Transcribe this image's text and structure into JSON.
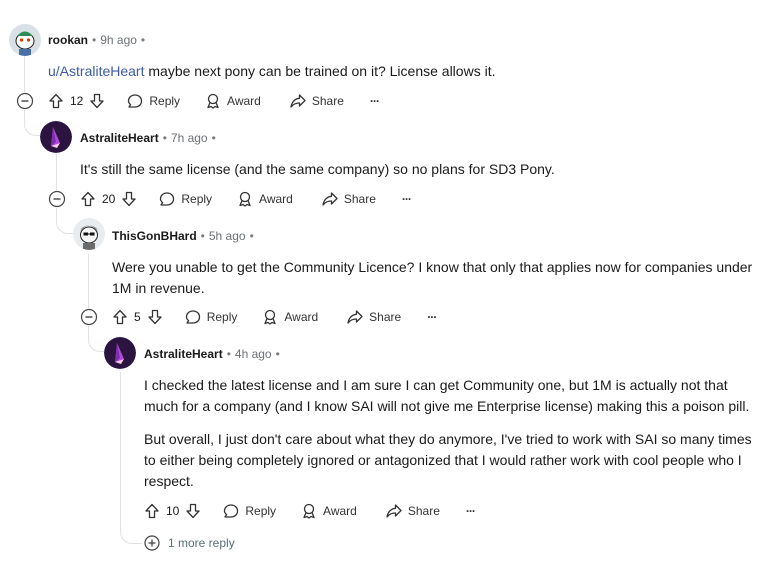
{
  "comments": [
    {
      "author": "rookan",
      "time": "9h ago",
      "mention": "u/AstraliteHeart",
      "body": "maybe next pony can be trained on it? License allows it.",
      "votes": "12"
    },
    {
      "author": "AstraliteHeart",
      "time": "7h ago",
      "body": "It's still the same license (and the same company) so no plans for SD3 Pony.",
      "votes": "20"
    },
    {
      "author": "ThisGonBHard",
      "time": "5h ago",
      "body_line1": "Were you unable to get the Community Licence? I know that only that applies now for companies under",
      "body_line2": "1M in revenue.",
      "votes": "5"
    },
    {
      "author": "AstraliteHeart",
      "time": "4h ago",
      "p1_line1": "I checked the latest license and I am sure I can get Community one, but 1M is actually not that",
      "p1_line2": "much for a company (and I know SAI will not give me Enterprise license) making this a poison pill.",
      "p2_line1": "But overall, I just don't care about what they do anymore, I've tried to work with SAI so many times",
      "p2_line2": "to either being completely ignored or antagonized that I would rather work with cool people who I",
      "p2_line3": "respect.",
      "votes": "10"
    }
  ],
  "actions": {
    "reply": "Reply",
    "award": "Award",
    "share": "Share",
    "more": "···"
  },
  "more_replies": "1 more reply",
  "separator": "•",
  "colors": {
    "thread_line": "#e0e2e4",
    "link": "#3b5ba5",
    "avatar_purple": "#2b1540",
    "text": "#1a1a1b",
    "meta": "#6b7176"
  },
  "icons": [
    "collapse-icon",
    "upvote-icon",
    "downvote-icon",
    "reply-icon",
    "award-icon",
    "share-icon",
    "more-icon",
    "expand-icon"
  ]
}
